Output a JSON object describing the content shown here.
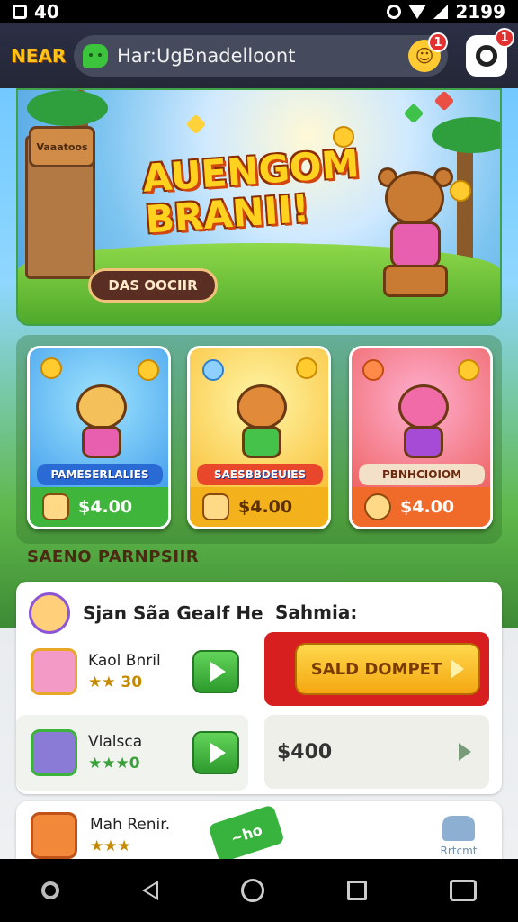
{
  "status_bar": {
    "left_text": "40",
    "right_text": "2199"
  },
  "app_bar": {
    "logo": "NEAR",
    "search_text": "Har:UgBnadelloont",
    "notification_count": "1",
    "settings_badge": "1"
  },
  "banner": {
    "sign_text": "Vaaatoos",
    "headline_line1": "AUENGOM",
    "headline_line2": "BRANII!",
    "button_label": "DAS OOCIIR"
  },
  "cards": [
    {
      "label": "PAMESERLALIES",
      "price": "$4.00",
      "color": "#2b8de6",
      "pet_color": "#f3c05a",
      "shirt_color": "#e85fb0"
    },
    {
      "label": "SAESBBDEUIES",
      "price": "$4.00",
      "color": "#f7b21a",
      "pet_color": "#e08a3a",
      "shirt_color": "#44c24a"
    },
    {
      "label": "PBNHCIOIOM",
      "price": "$4.00",
      "color": "#e94f45",
      "pet_color": "#f06ba8",
      "shirt_color": "#a54bd6"
    }
  ],
  "section": {
    "title": "SAENO PARNPSIIR"
  },
  "panel": {
    "left_title": "Sjan Sãa Gealf He",
    "right_title": "Sahmia:",
    "rows": [
      {
        "name": "Kaol Bnril",
        "stars": "★★ 30"
      },
      {
        "name": "Vlalsca",
        "stars": "★★★0"
      }
    ],
    "promo_label": "SALD DOMPET",
    "price": "$400"
  },
  "panel2": {
    "row_name": "Mah Renir.",
    "row_stars": "★★★",
    "ticket_text": "~ho",
    "corner_label": "Rrtcmt"
  },
  "colors": {
    "accent": "#ffc21a",
    "play_green": "#3aa13a",
    "promo_red": "#d71f1f"
  }
}
